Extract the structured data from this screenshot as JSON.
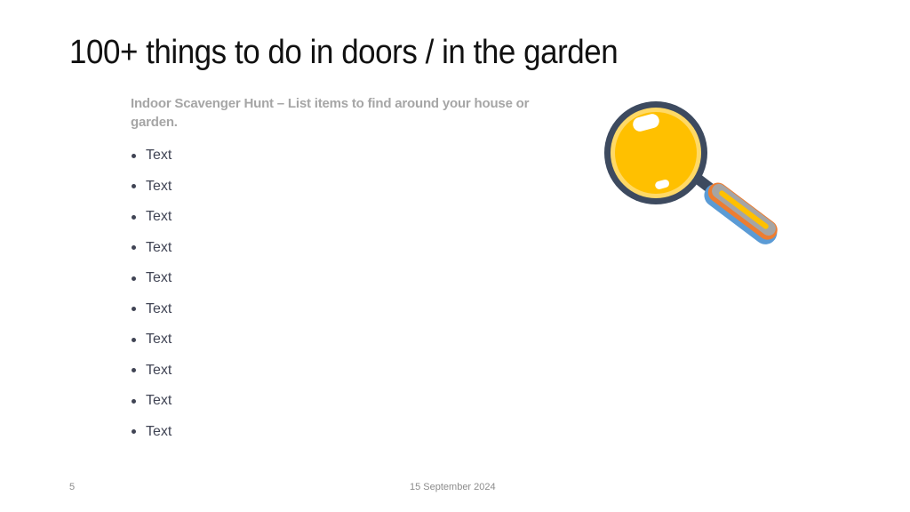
{
  "slide": {
    "title": "100+ things to do in doors / in the garden",
    "intro": "Indoor Scavenger Hunt – List items to find around your house or garden.",
    "bullets": [
      {
        "text": "Text"
      },
      {
        "text": "Text"
      },
      {
        "text": "Text"
      },
      {
        "text": "Text"
      },
      {
        "text": "Text"
      },
      {
        "text": "Text"
      },
      {
        "text": "Text"
      },
      {
        "text": "Text"
      },
      {
        "text": "Text"
      },
      {
        "text": "Text"
      }
    ],
    "illustration": {
      "icon": "magnifying-glass-icon",
      "colors": {
        "rim": "#3d4a5f",
        "lens": "#ffc000",
        "lens_inner_ring": "#ffd966",
        "handle_blue": "#5b9bd5",
        "handle_orange": "#ed7d31",
        "handle_gray": "#a5a5a5",
        "handle_yellow": "#ffc000"
      }
    }
  },
  "footer": {
    "page_number": "5",
    "date": "15 September 2024"
  }
}
